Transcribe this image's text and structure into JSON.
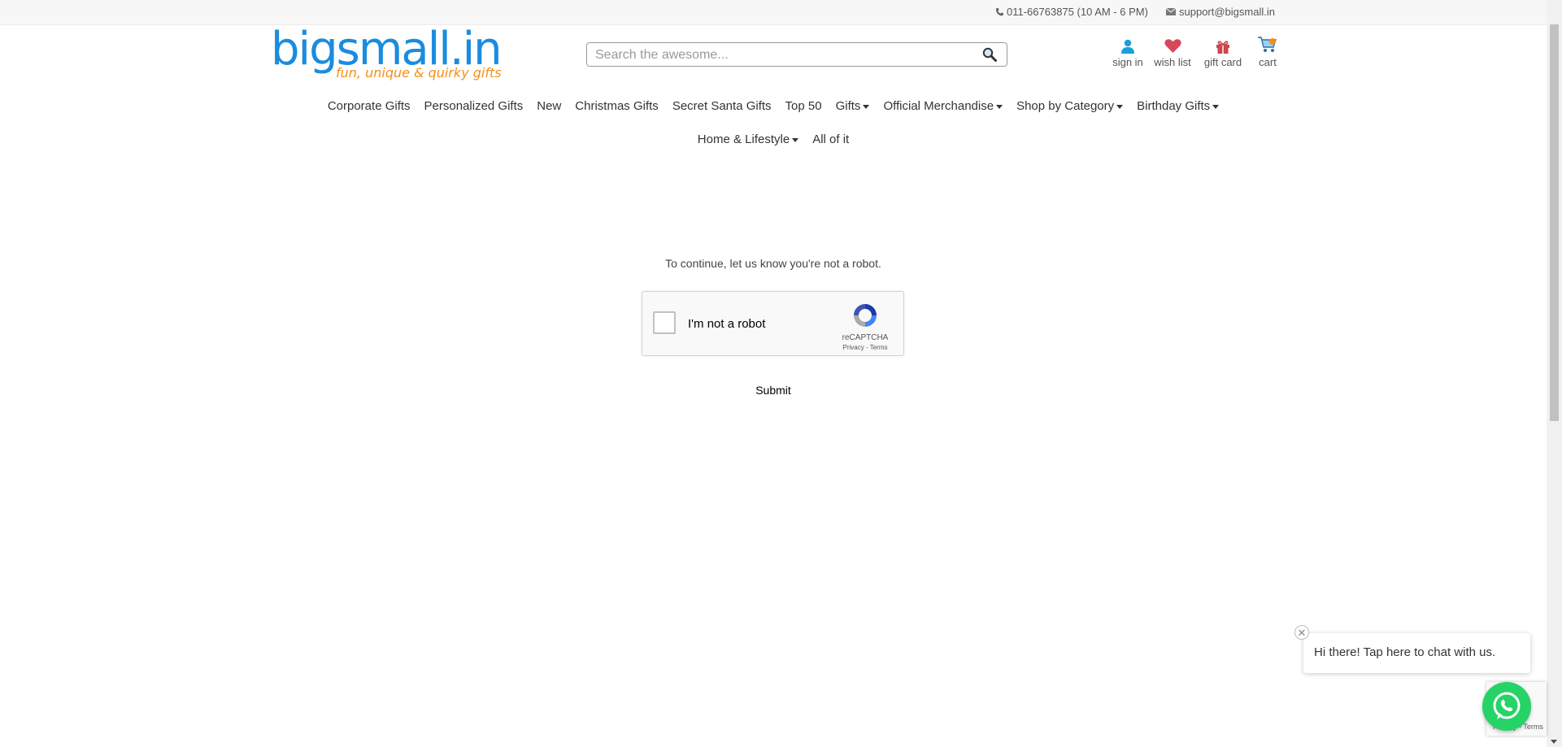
{
  "topbar": {
    "phone": "011-66763875 (10 AM - 6 PM)",
    "email": "support@bigsmall.in"
  },
  "logo": {
    "name": "bigsmall.in",
    "tagline": "fun, unique & quirky gifts"
  },
  "search": {
    "placeholder": "Search the awesome..."
  },
  "user_icons": [
    {
      "label": "sign in",
      "icon": "user-icon"
    },
    {
      "label": "wish list",
      "icon": "heart-icon"
    },
    {
      "label": "gift card",
      "icon": "gift-icon"
    },
    {
      "label": "cart",
      "icon": "cart-icon"
    }
  ],
  "nav": {
    "row1": [
      {
        "label": "Corporate Gifts",
        "dropdown": false
      },
      {
        "label": "Personalized Gifts",
        "dropdown": false
      },
      {
        "label": "New",
        "dropdown": false
      },
      {
        "label": "Christmas Gifts",
        "dropdown": false
      },
      {
        "label": "Secret Santa Gifts",
        "dropdown": false
      },
      {
        "label": "Top 50",
        "dropdown": false
      },
      {
        "label": "Gifts",
        "dropdown": true
      },
      {
        "label": "Official Merchandise",
        "dropdown": true
      },
      {
        "label": "Shop by Category",
        "dropdown": true
      },
      {
        "label": "Birthday Gifts",
        "dropdown": true
      }
    ],
    "row2": [
      {
        "label": "Home & Lifestyle",
        "dropdown": true
      },
      {
        "label": "All of it",
        "dropdown": false
      }
    ]
  },
  "captcha": {
    "message": "To continue, let us know you're not a robot.",
    "checkbox_label": "I'm not a robot",
    "brand": "reCAPTCHA",
    "privacy": "Privacy",
    "separator": " - ",
    "terms": "Terms",
    "submit_label": "Submit"
  },
  "chat": {
    "bubble_text": "Hi there! Tap here to chat with us.",
    "close_glyph": "✕"
  },
  "recaptcha_badge": {
    "links": "Privacy - Terms"
  },
  "colors": {
    "brand_blue": "#1a8ce0",
    "brand_orange": "#f29016",
    "whatsapp_green": "#25d366"
  }
}
